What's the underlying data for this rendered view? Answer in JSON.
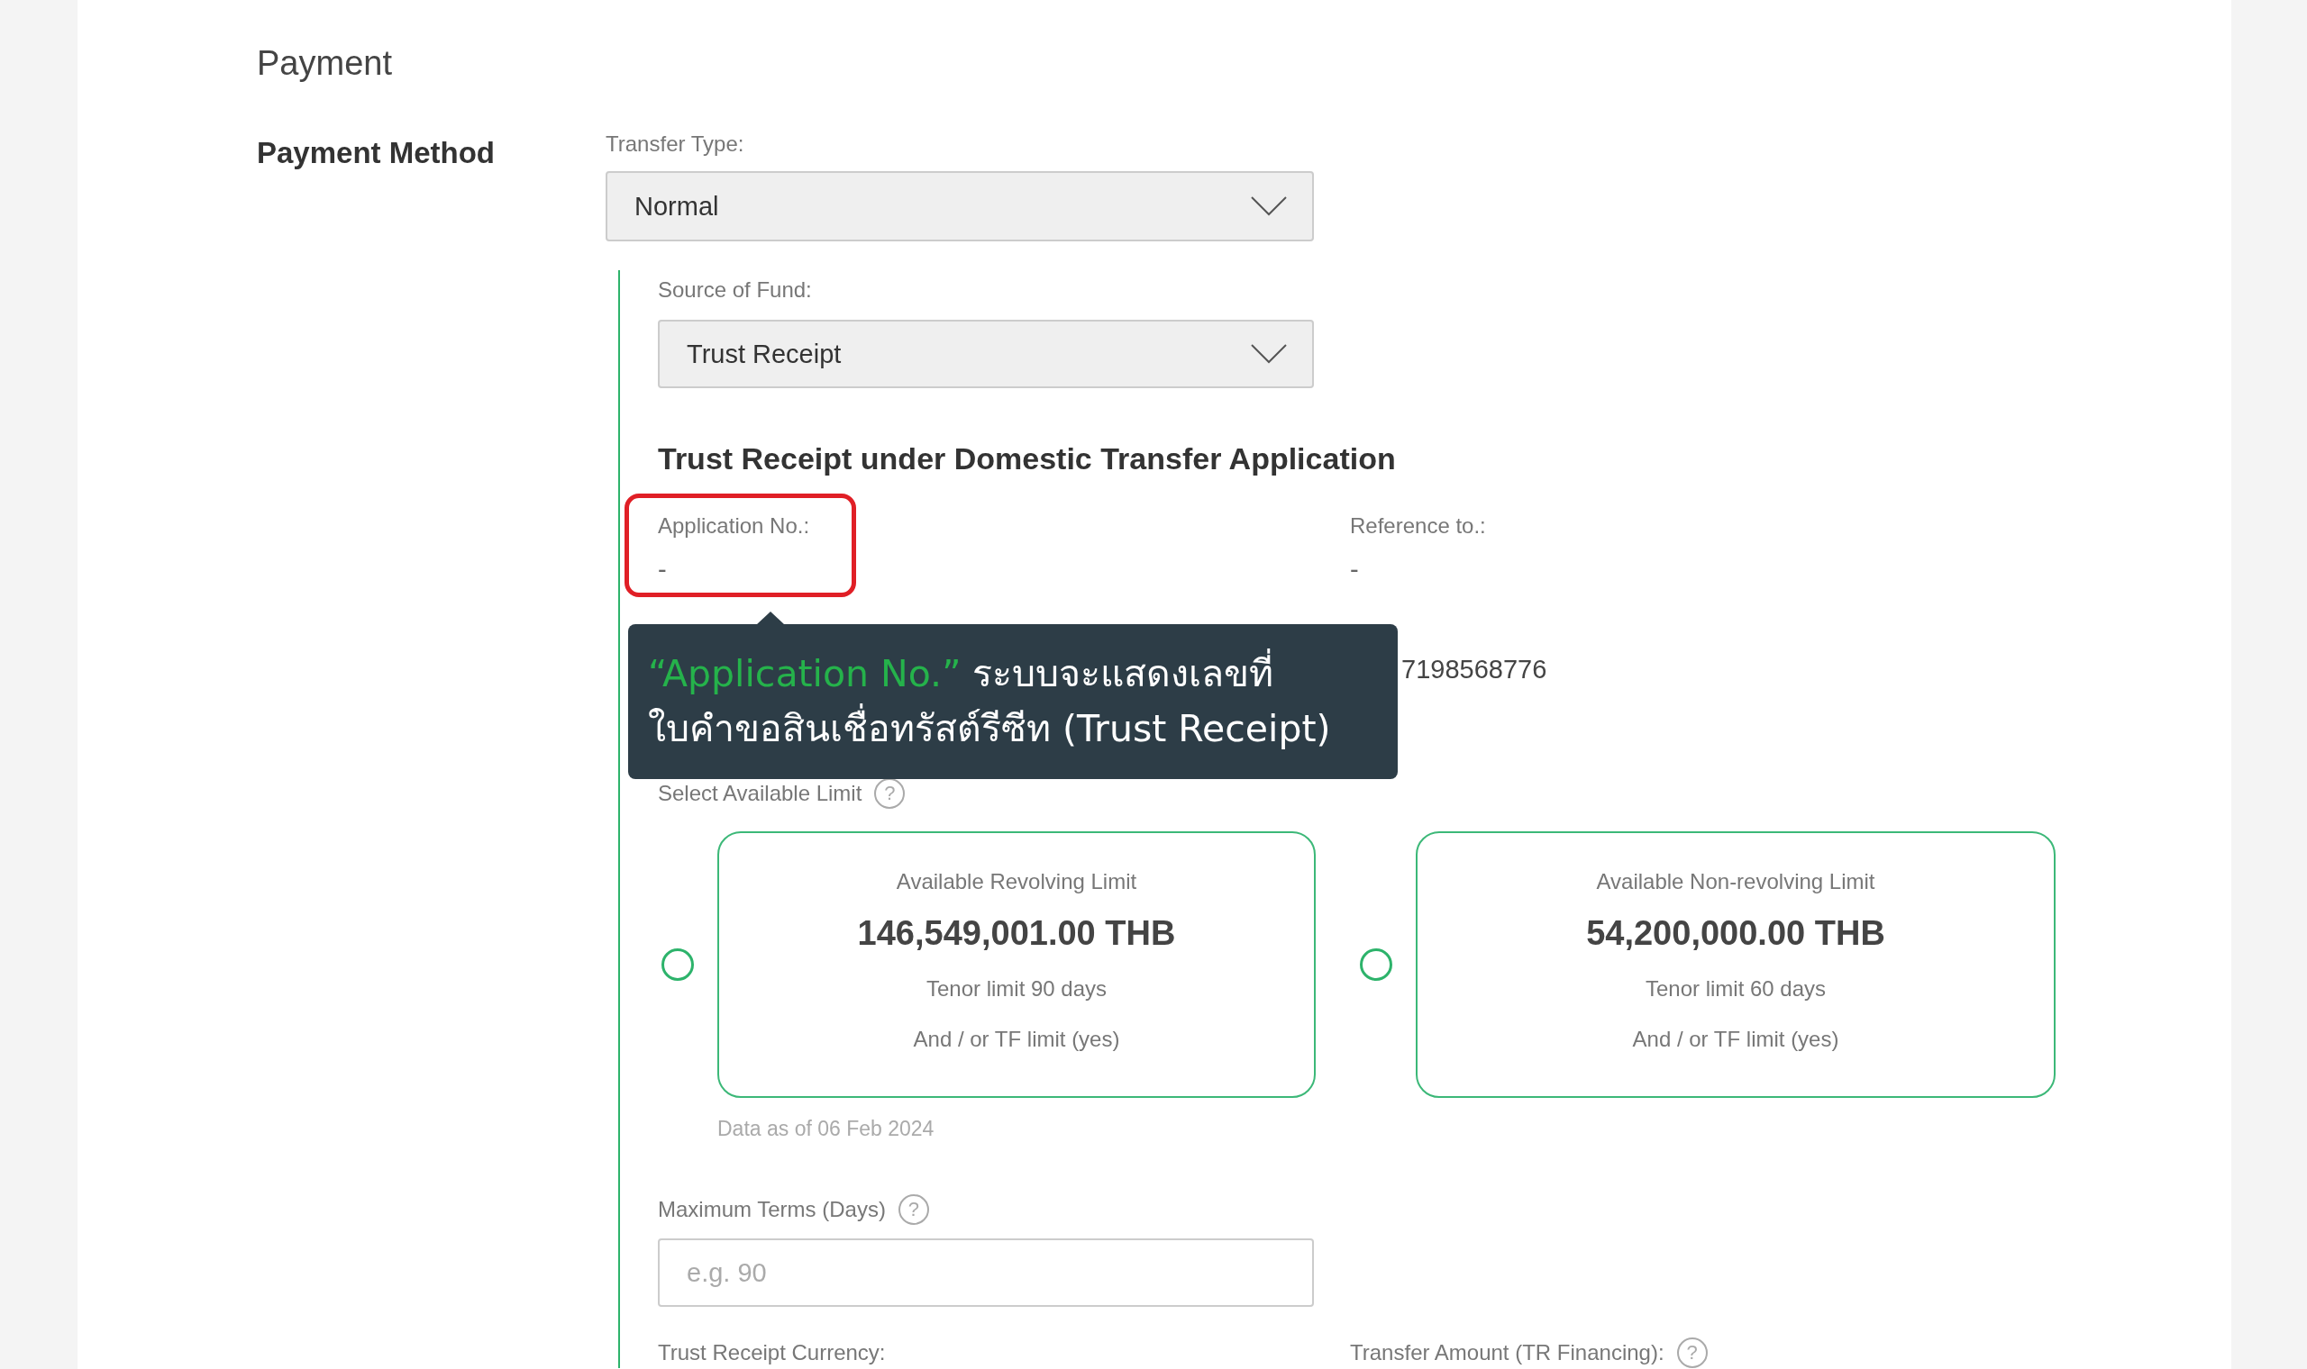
{
  "section_title": "Payment",
  "payment_method": {
    "label": "Payment Method",
    "transfer_type": {
      "label": "Transfer Type:",
      "value": "Normal"
    },
    "source_of_fund": {
      "label": "Source of Fund:",
      "value": "Trust Receipt"
    }
  },
  "application": {
    "title": "Trust Receipt under Domestic Transfer Application",
    "fields": [
      {
        "label": "Application No.:",
        "value": "-",
        "highlighted": true
      },
      {
        "label": "Reference to.:",
        "value": "-",
        "highlighted": false
      },
      {
        "value": "7198568776",
        "highlighted": false
      }
    ]
  },
  "tooltip": {
    "highlight": "“Application No.”",
    "text": "ระบบจะแสดงเลขที่\nใบคำขอสินเชื่อทรัสต์รีซีท (Trust Receipt)"
  },
  "limits": {
    "label": "Select Available Limit",
    "help": "?",
    "options": [
      {
        "title": "Available Revolving Limit",
        "amount": "146,549,001.00 THB",
        "tenor": "Tenor limit 90 days",
        "tf": "And / or TF limit (yes)",
        "selected": false
      },
      {
        "title": "Available Non-revolving Limit",
        "amount": "54,200,000.00 THB",
        "tenor": "Tenor limit 60 days",
        "tf": "And / or TF limit (yes)",
        "selected": false
      }
    ],
    "data_as_of": "Data as of 06 Feb 2024"
  },
  "maximum_terms": {
    "label": "Maximum Terms (Days)",
    "help": "?",
    "placeholder": "e.g. 90"
  },
  "bottom_fields": [
    {
      "label": "Trust Receipt Currency:"
    },
    {
      "label": "Transfer Amount (TR Financing):",
      "help": "?"
    }
  ]
}
